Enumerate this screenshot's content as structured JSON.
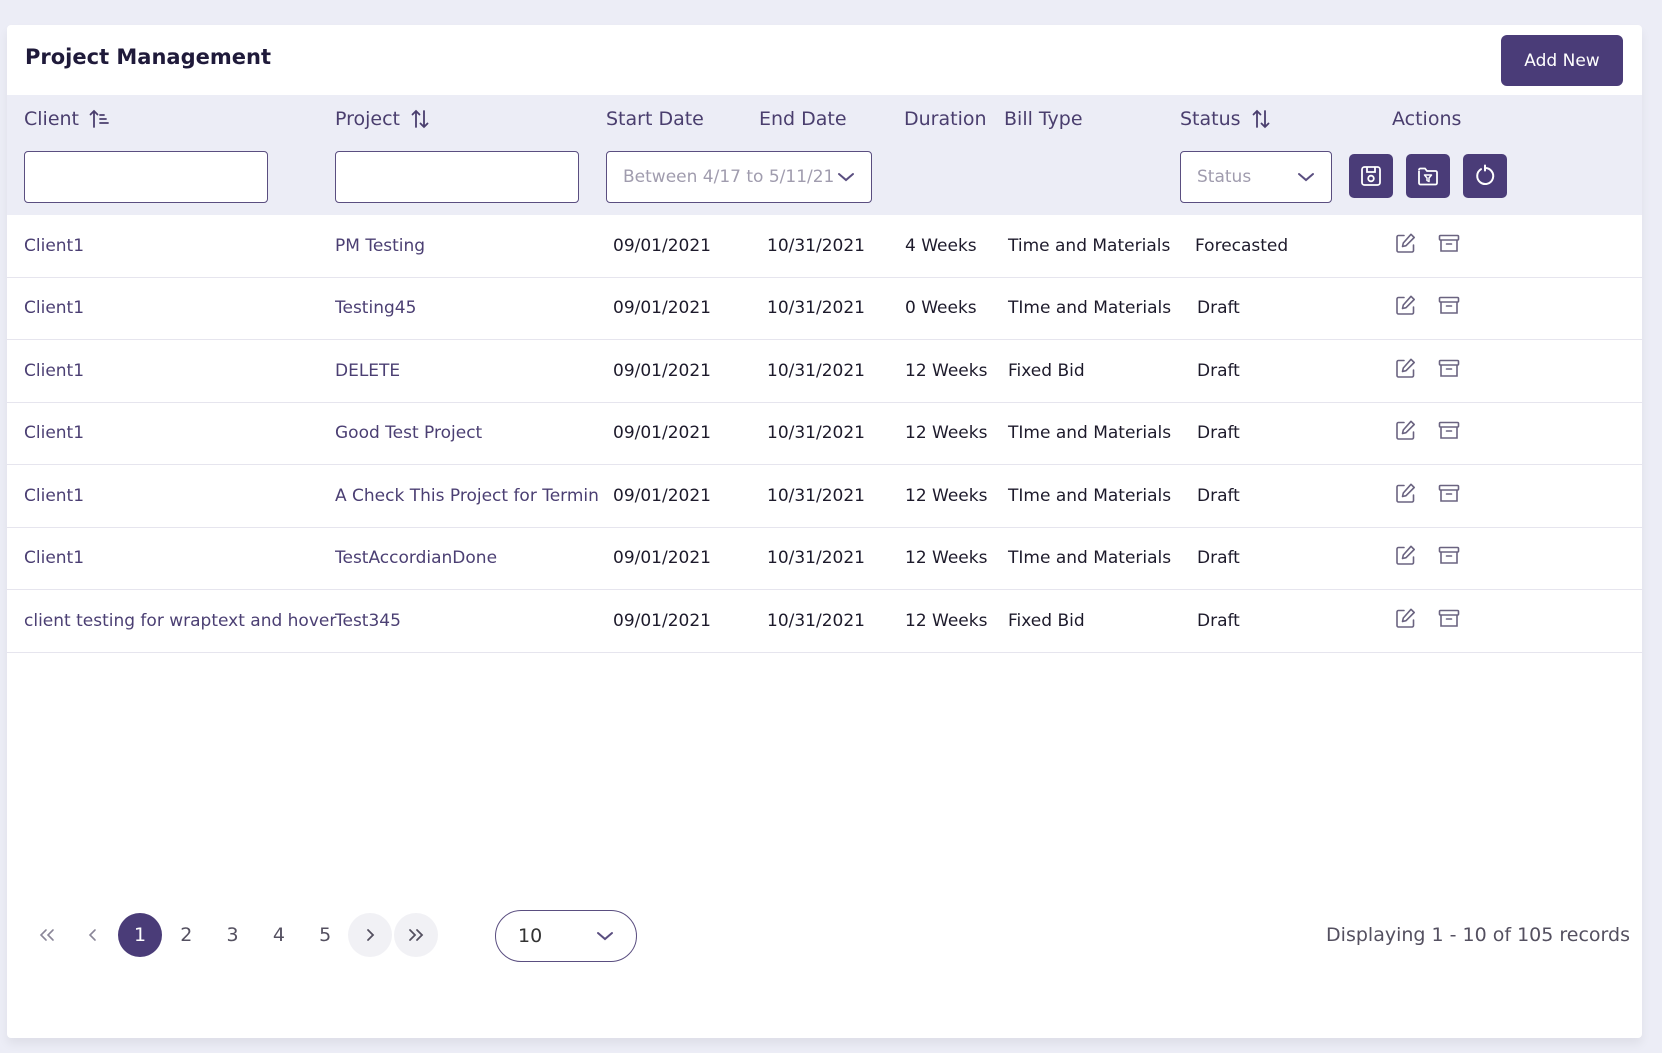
{
  "header": {
    "title": "Project Management",
    "add_new_label": "Add New"
  },
  "columns": {
    "client": "Client",
    "project": "Project",
    "start_date": "Start Date",
    "end_date": "End Date",
    "duration": "Duration",
    "bill_type": "Bill Type",
    "status": "Status",
    "actions": "Actions"
  },
  "filters": {
    "client_value": "",
    "project_value": "",
    "date_range": "Between 4/17 to 5/11/21",
    "status_placeholder": "Status"
  },
  "rows": [
    {
      "client": "Client1",
      "project": "PM Testing",
      "start": "09/01/2021",
      "end": "10/31/2021",
      "duration": "4 Weeks",
      "bill_type": "Time and Materials",
      "status": "Forecasted"
    },
    {
      "client": "Client1",
      "project": "Testing45",
      "start": "09/01/2021",
      "end": "10/31/2021",
      "duration": "0 Weeks",
      "bill_type": "TIme and Materials",
      "status": "Draft"
    },
    {
      "client": "Client1",
      "project": "DELETE",
      "start": "09/01/2021",
      "end": "10/31/2021",
      "duration": "12 Weeks",
      "bill_type": "Fixed Bid",
      "status": "Draft"
    },
    {
      "client": "Client1",
      "project": "Good Test Project",
      "start": "09/01/2021",
      "end": "10/31/2021",
      "duration": "12 Weeks",
      "bill_type": "TIme and Materials",
      "status": "Draft"
    },
    {
      "client": "Client1",
      "project": "A Check This Project for Termin",
      "start": "09/01/2021",
      "end": "10/31/2021",
      "duration": "12 Weeks",
      "bill_type": "TIme and Materials",
      "status": "Draft"
    },
    {
      "client": "Client1",
      "project": "TestAccordianDone",
      "start": "09/01/2021",
      "end": "10/31/2021",
      "duration": "12 Weeks",
      "bill_type": "TIme and Materials",
      "status": "Draft"
    },
    {
      "client": "client testing for wraptext and hover",
      "project": "Test345",
      "start": "09/01/2021",
      "end": "10/31/2021",
      "duration": "12 Weeks",
      "bill_type": "Fixed Bid",
      "status": "Draft"
    }
  ],
  "pagination": {
    "pages": [
      "1",
      "2",
      "3",
      "4",
      "5"
    ],
    "current_page": "1",
    "per_page": "10",
    "records_text": "Displaying 1 - 10 of 105 records"
  },
  "colors": {
    "accent": "#4a3c78",
    "header_bg": "#ecedf6",
    "link_text": "#4b3f73"
  },
  "icons": {
    "client_sort": "sort-ascending-icon",
    "sort": "sort-arrows-icon",
    "save_filter": "save-icon",
    "saved_filters": "folder-filter-icon",
    "reset": "refresh-icon",
    "edit": "edit-icon",
    "archive": "archive-icon"
  }
}
